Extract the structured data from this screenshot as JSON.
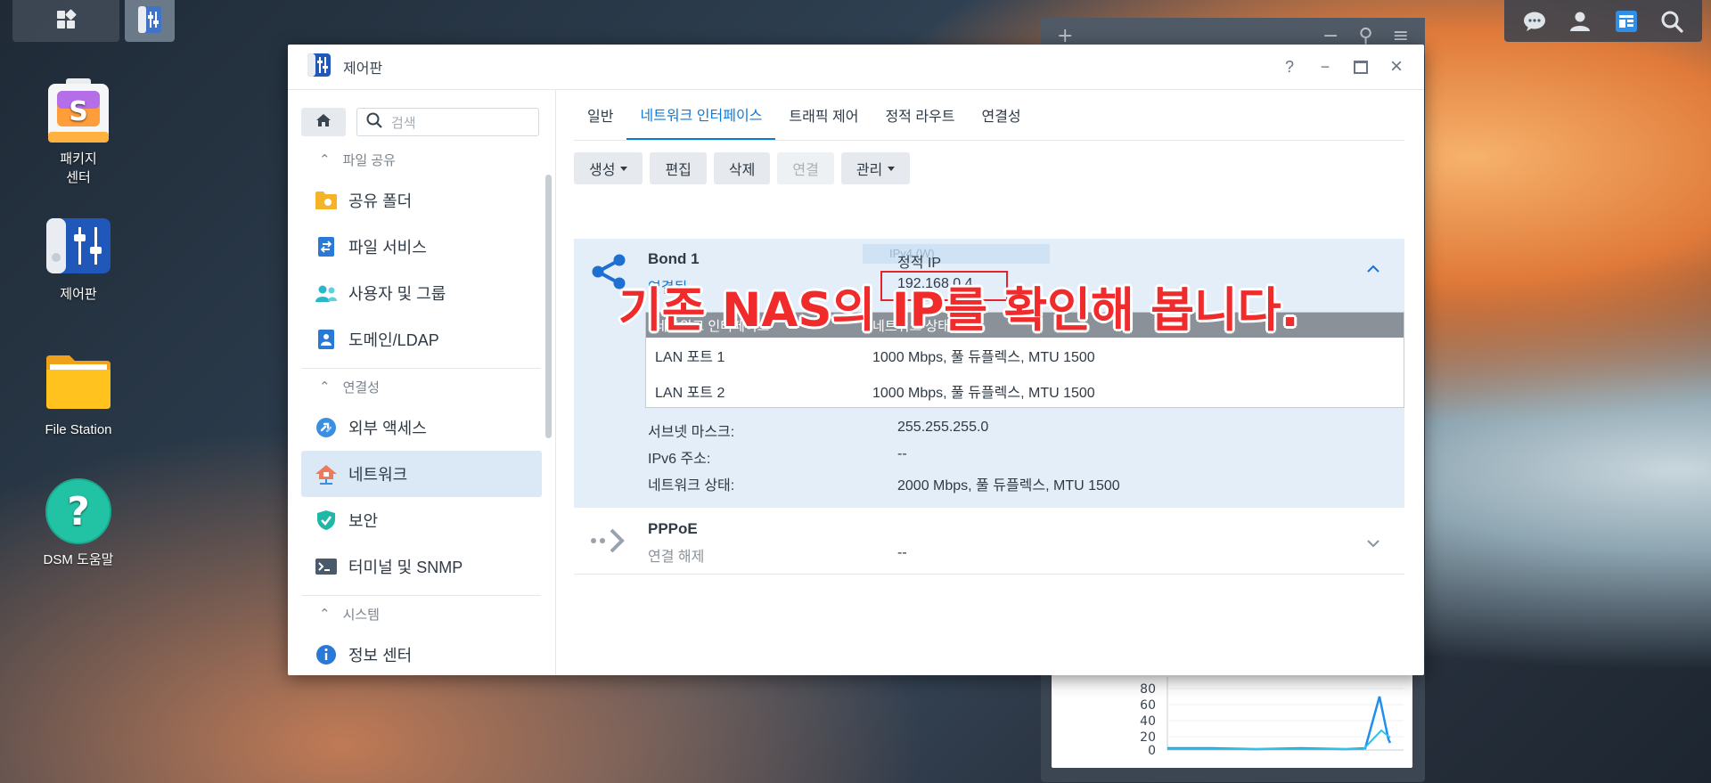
{
  "desktop": {
    "icons": [
      {
        "label_line1": "패키지",
        "label_line2": "센터"
      },
      {
        "label_line1": "제어판",
        "label_line2": ""
      },
      {
        "label_line1": "File Station",
        "label_line2": ""
      },
      {
        "label_line1": "DSM 도움말",
        "label_line2": ""
      }
    ]
  },
  "widget": {
    "chart_ticks": [
      "80",
      "60",
      "40",
      "20",
      "0"
    ]
  },
  "window": {
    "title": "제어판",
    "controls": {
      "help": "?",
      "minimize": "−",
      "maximize": "□",
      "close": "×"
    }
  },
  "sidebar": {
    "search_placeholder": "검색",
    "sections": [
      {
        "label": "파일 공유",
        "items": [
          "공유 폴더",
          "파일 서비스",
          "사용자 및 그룹",
          "도메인/LDAP"
        ]
      },
      {
        "label": "연결성",
        "items": [
          "외부 액세스",
          "네트워크",
          "보안",
          "터미널 및 SNMP"
        ]
      },
      {
        "label": "시스템",
        "items": [
          "정보 센터"
        ]
      }
    ],
    "active_item": "네트워크"
  },
  "tabs": [
    "일반",
    "네트워크 인터페이스",
    "트래픽 제어",
    "정적 라우트",
    "연결성"
  ],
  "active_tab": "네트워크 인터페이스",
  "toolbar": {
    "create": "생성",
    "edit": "편집",
    "delete": "삭제",
    "connect": "연결",
    "manage": "관리"
  },
  "bond": {
    "name": "Bond 1",
    "status": "연결됨",
    "faded_tag": "IPv4 (W)",
    "type": "정적 IP",
    "ip": "192.168.0.4",
    "table_headers": [
      "네트워크 인터페이스",
      "네트워크 상태"
    ],
    "ports": [
      {
        "name": "LAN 포트 1",
        "status": "1000 Mbps, 풀 듀플렉스, MTU 1500"
      },
      {
        "name": "LAN 포트 2",
        "status": "1000 Mbps, 풀 듀플렉스, MTU 1500"
      }
    ],
    "subnet_label": "서브넷 마스크:",
    "subnet_value": "255.255.255.0",
    "ipv6_label": "IPv6 주소:",
    "ipv6_value": "--",
    "netstat_label": "네트워크 상태:",
    "netstat_value": "2000 Mbps, 풀 듀플렉스, MTU 1500"
  },
  "pppoe": {
    "name": "PPPoE",
    "status": "연결 해제",
    "value": "--"
  },
  "overlay_caption": "기존 NAS의 IP를 확인해 봅니다.",
  "colors": {
    "accent": "#0f7ad6",
    "highlight_box": "#e0262b",
    "caption": "#ef2b2b"
  }
}
